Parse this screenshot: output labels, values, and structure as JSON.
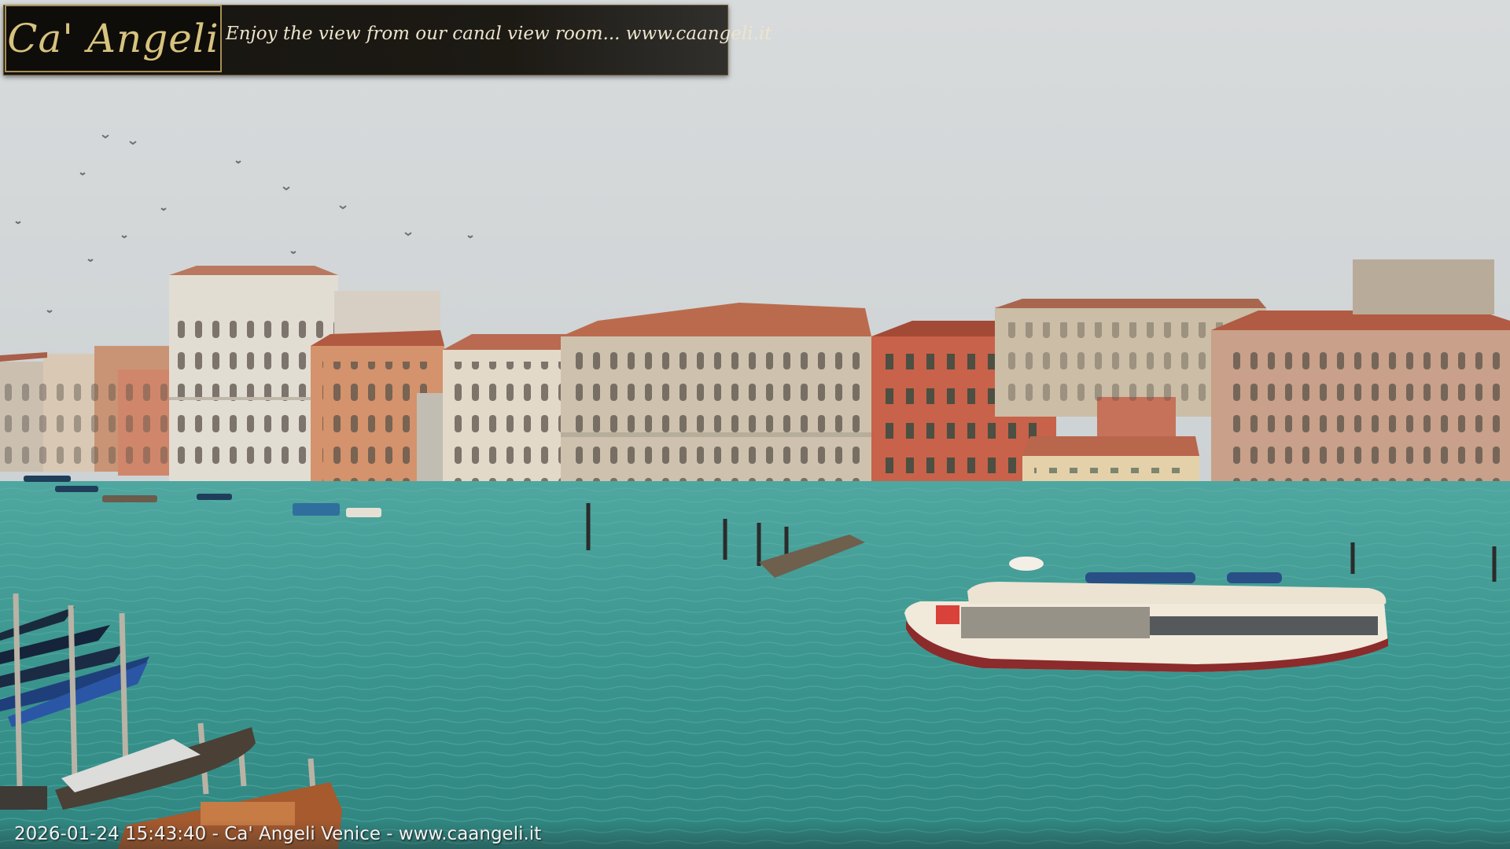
{
  "overlay": {
    "logo_text": "Ca' Angeli",
    "tagline": "Enjoy the view from our canal view room... www.caangeli.it"
  },
  "caption": {
    "text": "2026-01-24 15:43:40 - Ca' Angeli Venice - www.caangeli.it"
  },
  "scene": {
    "description_colors": {
      "sky": "#d3d7d9",
      "water": "#3d9c95",
      "water_dark": "#2f7f79",
      "brick_red": "#c65a43",
      "stucco_pink": "#c79a80",
      "stone": "#cfc6b5",
      "vaporetto_hull": "#f2eadc",
      "vaporetto_stripe": "#8c2b2b"
    }
  }
}
